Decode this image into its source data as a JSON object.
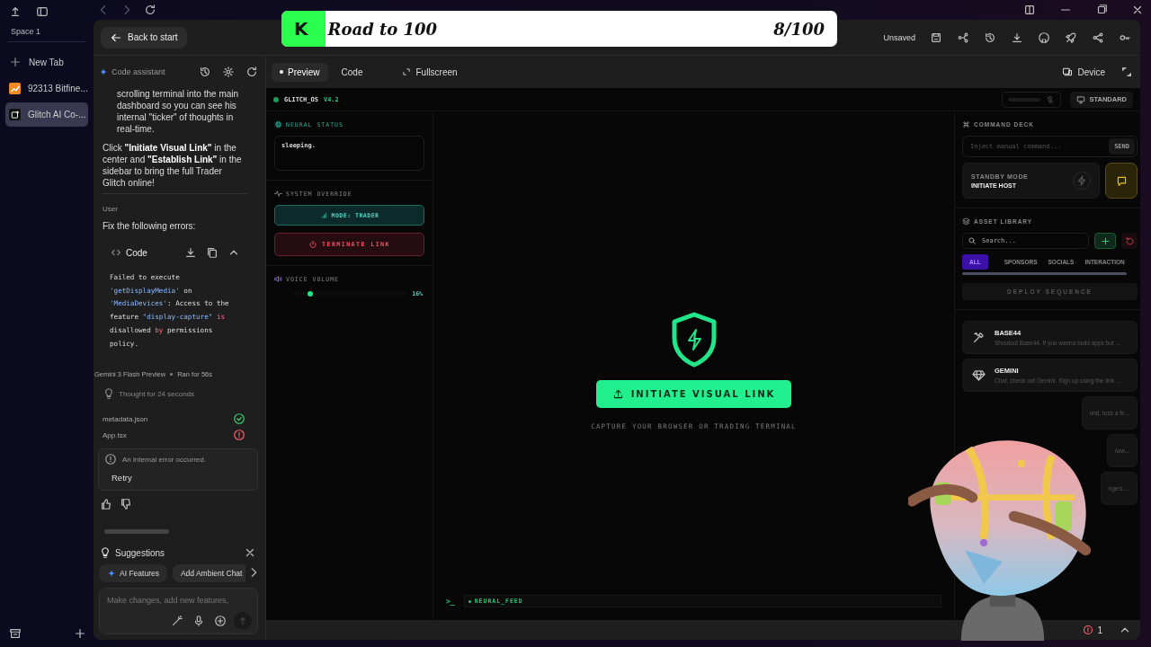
{
  "browser": {
    "space": "Space 1",
    "tabs": [
      {
        "label": "New Tab",
        "kind": "new",
        "selected": false
      },
      {
        "label": "92313 Bitfine...",
        "kind": "chart",
        "selected": false
      },
      {
        "label": "Glitch AI Co-...",
        "kind": "app",
        "selected": true
      }
    ]
  },
  "overlay": {
    "badge": "K",
    "title": "Road to 100",
    "count": "8/100",
    "level": 0.08
  },
  "toolbar": {
    "back": "Back to start",
    "save_state": "Unsaved"
  },
  "chat": {
    "title": "Code assistant",
    "list_item": "scrolling terminal into the main dashboard so you can see his internal \"ticker\" of thoughts in real-time.",
    "paragraph": "Click **\"Initiate Visual Link\"** in the center and **\"Establish Link\"** in the sidebar to bring the full Trader Glitch online!",
    "user_label": "User",
    "user_message": "Fix the following errors:",
    "code": {
      "title": "Code",
      "segments": [
        {
          "text": "Failed to execute ",
          "kind": "plain"
        },
        {
          "text": "'getDisplayMedia'",
          "kind": "string"
        },
        {
          "text": " on ",
          "kind": "plain"
        },
        {
          "text": "'MediaDevices'",
          "kind": "string"
        },
        {
          "text": ": Access to the feature ",
          "kind": "plain"
        },
        {
          "text": "\"display-capture\"",
          "kind": "string"
        },
        {
          "text": " is",
          "kind": "keyword"
        },
        {
          "text": " disallowed ",
          "kind": "plain"
        },
        {
          "text": "by",
          "kind": "keyword"
        },
        {
          "text": " permissions policy.",
          "kind": "plain"
        }
      ]
    },
    "model": "Gemini 3 Flash Preview",
    "run_time": "Ran for 56s",
    "thought": "Thought for 24 seconds",
    "files": [
      {
        "name": "metadata.json",
        "passed": true
      },
      {
        "name": "App.tsx",
        "passed": false
      }
    ],
    "error": "An internal error occurred.",
    "retry": "Retry",
    "suggestions": {
      "title": "Suggestions",
      "chips": [
        {
          "label": "AI Features",
          "kind": "ai"
        },
        {
          "label": "Add Ambient Chat",
          "kind": "plain"
        }
      ]
    },
    "input_placeholder": "Make changes, add new features,"
  },
  "view_tabs": [
    {
      "label": "Preview",
      "selected": true
    },
    {
      "label": "Code",
      "selected": false
    }
  ],
  "fullscreen": "Fullscreen",
  "device": "Device",
  "app": {
    "title": "GLITCH_OS",
    "version": "V4.2",
    "display_mode": "STANDARD",
    "neural_status": {
      "title": "NEURAL STATUS",
      "value": "sleeping."
    },
    "override": {
      "title": "SYSTEM OVERRIDE",
      "mode": "MODE: TRADER",
      "terminate": "TERMINATE LINK"
    },
    "volume": {
      "title": "VOICE VOLUME",
      "level": 0.16,
      "reading": "16%"
    },
    "cta": "INITIATE VISUAL LINK",
    "caption": "CAPTURE YOUR BROWSER OR TRADING TERMINAL",
    "feed": {
      "prompt": ">_",
      "label": "NEURAL_FEED"
    },
    "command_deck": {
      "title": "COMMAND DECK",
      "placeholder": "Inject manual command...",
      "send": "SEND",
      "standby_label": "STANDBY MODE",
      "standby_action": "INITIATE HOST"
    },
    "assets": {
      "title": "ASSET LIBRARY",
      "search_placeholder": "Search...",
      "tabs": [
        {
          "label": "ALL",
          "selected": true
        },
        {
          "label": "SPONSORS",
          "selected": false
        },
        {
          "label": "SOCIALS",
          "selected": false
        },
        {
          "label": "INTERACTION",
          "selected": false
        }
      ],
      "deploy": "DEPLOY SEQUENCE",
      "items": [
        {
          "kind": "tools",
          "name": "BASE44",
          "description": "Shoutout Base44. If you wanna build apps but ..."
        },
        {
          "kind": "gem",
          "name": "GEMINI",
          "description": "Chat, check out Gemini. Sign up using the link ..."
        },
        {
          "kind": "covered",
          "description": "und, toss a fe..."
        },
        {
          "kind": "covered",
          "description": "/ww..."
        },
        {
          "kind": "covered",
          "description": "ngers ..."
        }
      ]
    }
  },
  "status_bar": {
    "error_count": "1"
  }
}
